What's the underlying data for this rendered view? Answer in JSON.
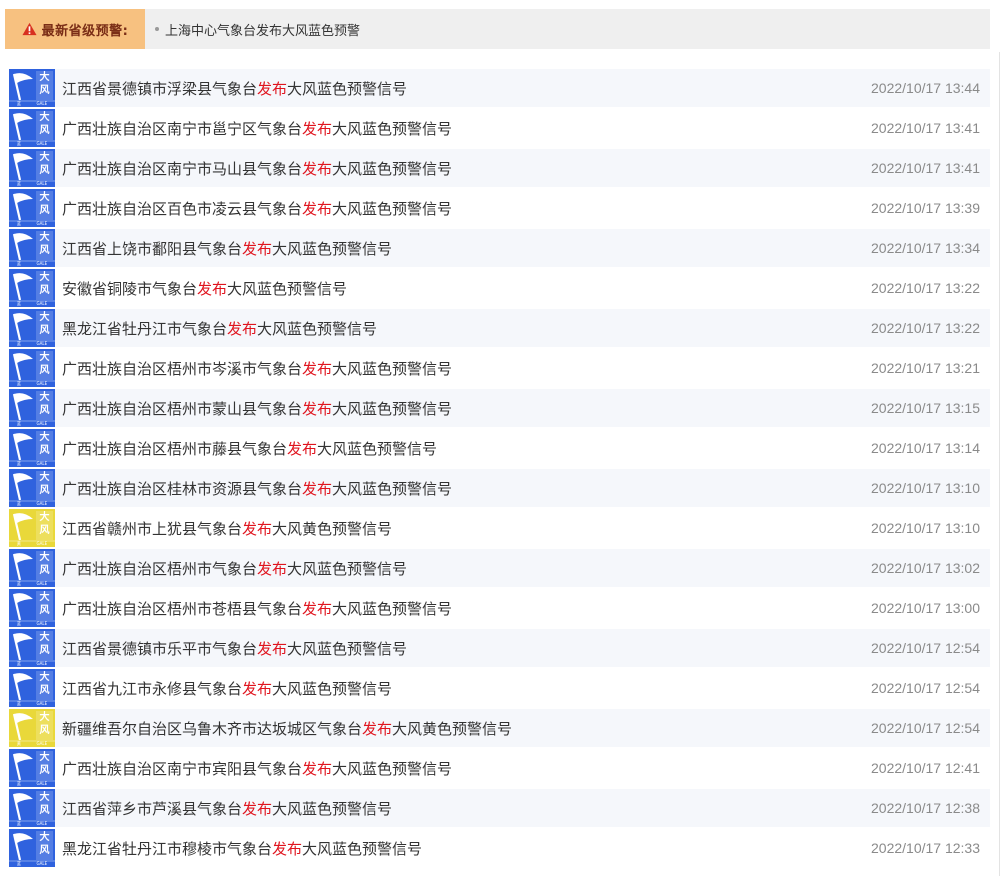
{
  "banner": {
    "label": "最新省级预警:",
    "message": "上海中心气象台发布大风蓝色预警"
  },
  "colors": {
    "blue": "#2f62de",
    "yellow": "#e9d83a",
    "highlight": "#e0141e",
    "banner_label_bg": "#f7c180",
    "banner_label_text": "#7a2d16",
    "banner_bg": "#efefef",
    "row_bg": "#f5f7fb",
    "time": "#8a8a8a"
  },
  "icon_text": {
    "line1": "大",
    "line2": "风",
    "foot_left": "蓝",
    "foot_right": "GALE",
    "foot_left_yellow": "黄"
  },
  "alerts": [
    {
      "pre": "江西省景德镇市浮梁县气象台",
      "verb": "发布",
      "post": "大风蓝色预警信号",
      "time": "2022/10/17 13:44",
      "level": "blue"
    },
    {
      "pre": "广西壮族自治区南宁市邕宁区气象台",
      "verb": "发布",
      "post": "大风蓝色预警信号",
      "time": "2022/10/17 13:41",
      "level": "blue"
    },
    {
      "pre": "广西壮族自治区南宁市马山县气象台",
      "verb": "发布",
      "post": "大风蓝色预警信号",
      "time": "2022/10/17 13:41",
      "level": "blue"
    },
    {
      "pre": "广西壮族自治区百色市凌云县气象台",
      "verb": "发布",
      "post": "大风蓝色预警信号",
      "time": "2022/10/17 13:39",
      "level": "blue"
    },
    {
      "pre": "江西省上饶市鄱阳县气象台",
      "verb": "发布",
      "post": "大风蓝色预警信号",
      "time": "2022/10/17 13:34",
      "level": "blue"
    },
    {
      "pre": "安徽省铜陵市气象台",
      "verb": "发布",
      "post": "大风蓝色预警信号",
      "time": "2022/10/17 13:22",
      "level": "blue"
    },
    {
      "pre": "黑龙江省牡丹江市气象台",
      "verb": "发布",
      "post": "大风蓝色预警信号",
      "time": "2022/10/17 13:22",
      "level": "blue"
    },
    {
      "pre": "广西壮族自治区梧州市岑溪市气象台",
      "verb": "发布",
      "post": "大风蓝色预警信号",
      "time": "2022/10/17 13:21",
      "level": "blue"
    },
    {
      "pre": "广西壮族自治区梧州市蒙山县气象台",
      "verb": "发布",
      "post": "大风蓝色预警信号",
      "time": "2022/10/17 13:15",
      "level": "blue"
    },
    {
      "pre": "广西壮族自治区梧州市藤县气象台",
      "verb": "发布",
      "post": "大风蓝色预警信号",
      "time": "2022/10/17 13:14",
      "level": "blue"
    },
    {
      "pre": "广西壮族自治区桂林市资源县气象台",
      "verb": "发布",
      "post": "大风蓝色预警信号",
      "time": "2022/10/17 13:10",
      "level": "blue"
    },
    {
      "pre": "江西省赣州市上犹县气象台",
      "verb": "发布",
      "post": "大风黄色预警信号",
      "time": "2022/10/17 13:10",
      "level": "yellow"
    },
    {
      "pre": "广西壮族自治区梧州市气象台",
      "verb": "发布",
      "post": "大风蓝色预警信号",
      "time": "2022/10/17 13:02",
      "level": "blue"
    },
    {
      "pre": "广西壮族自治区梧州市苍梧县气象台",
      "verb": "发布",
      "post": "大风蓝色预警信号",
      "time": "2022/10/17 13:00",
      "level": "blue"
    },
    {
      "pre": "江西省景德镇市乐平市气象台",
      "verb": "发布",
      "post": "大风蓝色预警信号",
      "time": "2022/10/17 12:54",
      "level": "blue"
    },
    {
      "pre": "江西省九江市永修县气象台",
      "verb": "发布",
      "post": "大风蓝色预警信号",
      "time": "2022/10/17 12:54",
      "level": "blue"
    },
    {
      "pre": "新疆维吾尔自治区乌鲁木齐市达坂城区气象台",
      "verb": "发布",
      "post": "大风黄色预警信号",
      "time": "2022/10/17 12:54",
      "level": "yellow"
    },
    {
      "pre": "广西壮族自治区南宁市宾阳县气象台",
      "verb": "发布",
      "post": "大风蓝色预警信号",
      "time": "2022/10/17 12:41",
      "level": "blue"
    },
    {
      "pre": "江西省萍乡市芦溪县气象台",
      "verb": "发布",
      "post": "大风蓝色预警信号",
      "time": "2022/10/17 12:38",
      "level": "blue"
    },
    {
      "pre": "黑龙江省牡丹江市穆棱市气象台",
      "verb": "发布",
      "post": "大风蓝色预警信号",
      "time": "2022/10/17 12:33",
      "level": "blue"
    }
  ]
}
